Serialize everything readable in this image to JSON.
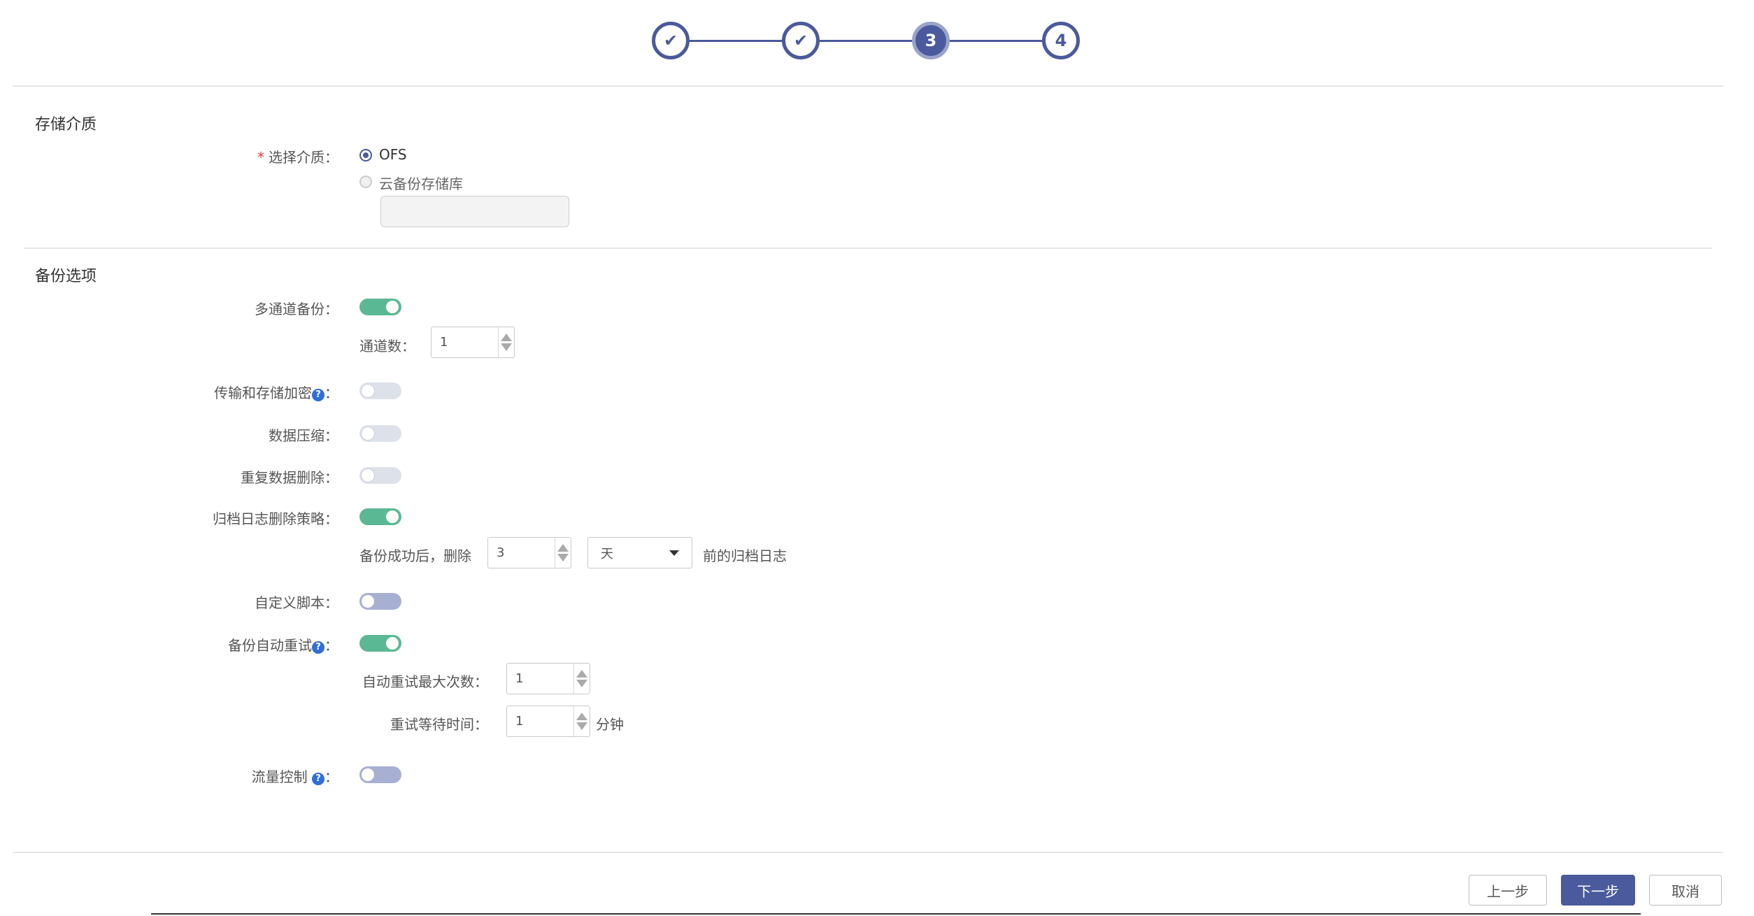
{
  "stepper": {
    "steps": [
      {
        "label": "✔",
        "state": "done"
      },
      {
        "label": "✔",
        "state": "done"
      },
      {
        "label": "3",
        "state": "active"
      },
      {
        "label": "4",
        "state": "todo"
      }
    ]
  },
  "storage": {
    "title": "存储介质",
    "required_mark": "*",
    "medium_label": "选择介质：",
    "options": [
      "OFS",
      "云备份存储库"
    ],
    "selected": "OFS",
    "cloud_input_value": ""
  },
  "backup": {
    "title": "备份选项",
    "multichannel": {
      "label": "多通道备份：",
      "enabled": true,
      "channels_label": "通道数：",
      "channels": "1"
    },
    "encryption": {
      "label": "传输和存储加密",
      "help": "?",
      "colon": "：",
      "enabled": false
    },
    "compression": {
      "label": "数据压缩：",
      "enabled": false
    },
    "dedup": {
      "label": "重复数据删除：",
      "enabled": false
    },
    "archive_policy": {
      "label": "归档日志删除策略：",
      "enabled": true,
      "prefix": "备份成功后，删除",
      "value": "3",
      "unit": "天",
      "suffix": "前的归档日志"
    },
    "custom_script": {
      "label": "自定义脚本：",
      "enabled": false
    },
    "auto_retry": {
      "label": "备份自动重试",
      "help": "?",
      "colon": "：",
      "enabled": true,
      "max_label": "自动重试最大次数：",
      "max_value": "1",
      "wait_label": "重试等待时间：",
      "wait_value": "1",
      "wait_unit": "分钟"
    },
    "flow_control": {
      "label": "流量控制 ",
      "help": "?",
      "colon": "：",
      "enabled": false
    }
  },
  "footer": {
    "prev": "上一步",
    "next": "下一步",
    "cancel": "取消"
  },
  "colors": {
    "primary": "#4a5a9c",
    "toggle_on": "#5bb894",
    "toggle_off": "#dde1ea",
    "help": "#2f6fd8"
  }
}
